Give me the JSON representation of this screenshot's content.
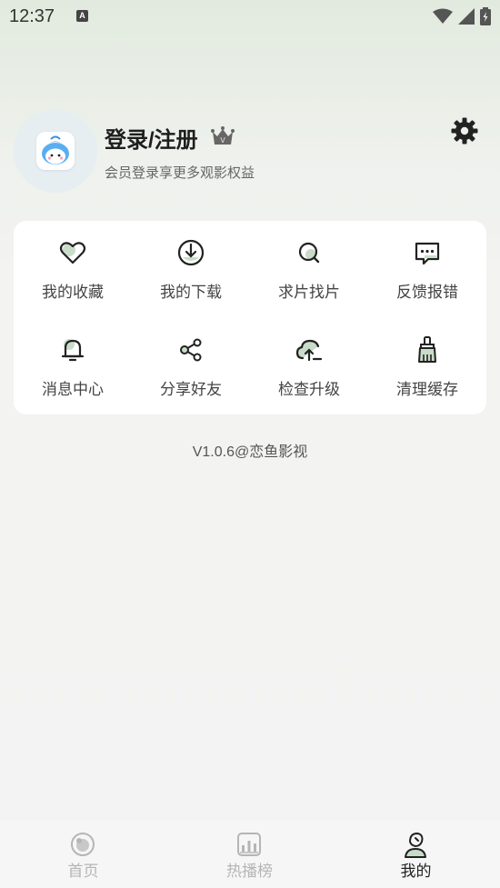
{
  "status_bar": {
    "time": "12:37",
    "notif_letter": "A"
  },
  "profile": {
    "name": "登录/注册",
    "subtitle": "会员登录享更多观影权益",
    "crown_letter": "V"
  },
  "menu": {
    "row1": [
      "我的收藏",
      "我的下载",
      "求片找片",
      "反馈报错"
    ],
    "row2": [
      "消息中心",
      "分享好友",
      "检查升级",
      "清理缓存"
    ]
  },
  "version": "V1.0.6@恋鱼影视",
  "tabs": [
    "首页",
    "热播榜",
    "我的"
  ],
  "colors": {
    "accent": "#c9dcc9",
    "active": "#222222",
    "inactive": "#b5b5b5"
  }
}
